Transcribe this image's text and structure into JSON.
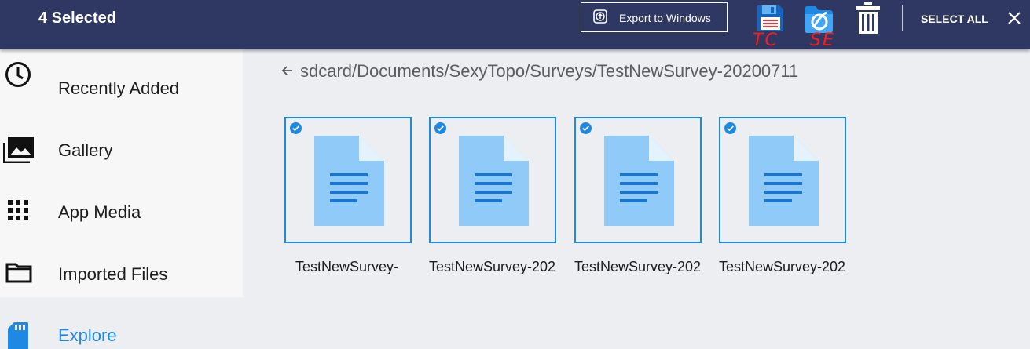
{
  "header": {
    "selected_count": "4 Selected",
    "export_label": "Export to Windows",
    "tc_annotation": "TC",
    "se_annotation": "SE",
    "select_all_label": "SELECT ALL"
  },
  "sidebar": {
    "items": [
      {
        "label": "Recently Added",
        "icon": "clock-icon"
      },
      {
        "label": "Gallery",
        "icon": "gallery-icon"
      },
      {
        "label": "App Media",
        "icon": "grid-icon"
      },
      {
        "label": "Imported Files",
        "icon": "folder-icon"
      },
      {
        "label": "Explore",
        "icon": "sdcard-icon",
        "active": true
      }
    ]
  },
  "main": {
    "path": "sdcard/Documents/SexyTopo/Surveys/TestNewSurvey-20200711",
    "files": [
      {
        "name": "TestNewSurvey-",
        "selected": true
      },
      {
        "name": "TestNewSurvey-202",
        "selected": true
      },
      {
        "name": "TestNewSurvey-202",
        "selected": true
      },
      {
        "name": "TestNewSurvey-202",
        "selected": true
      }
    ]
  },
  "colors": {
    "header_bg": "#2f3862",
    "accent": "#1e88e5",
    "doc_light": "#90caf9",
    "doc_lines": "#1976d2",
    "annotation": "#ff1a1a"
  }
}
